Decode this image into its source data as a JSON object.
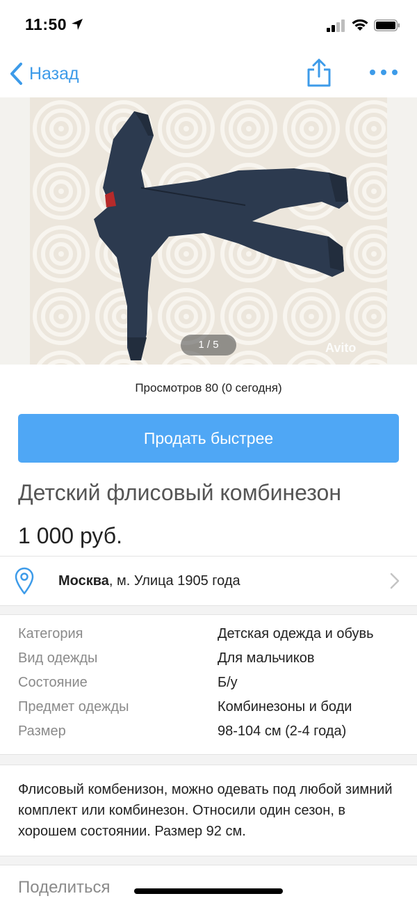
{
  "status_bar": {
    "time": "11:50"
  },
  "nav": {
    "back_label": "Назад",
    "accent_color": "#3d9be9"
  },
  "photo": {
    "counter": "1 / 5",
    "watermark": "Avito"
  },
  "views_text": "Просмотров 80 (0 сегодня)",
  "sell_button_label": "Продать быстрее",
  "listing": {
    "title": "Детский флисовый комбинезон",
    "price": "1 000 руб."
  },
  "location": {
    "city": "Москва",
    "metro": ", м. Улица 1905 года"
  },
  "params": [
    {
      "key": "Категория",
      "value": "Детская одежда и обувь"
    },
    {
      "key": "Вид одежды",
      "value": "Для мальчиков"
    },
    {
      "key": "Состояние",
      "value": "Б/у"
    },
    {
      "key": "Предмет одежды",
      "value": "Комбинезоны и боди"
    },
    {
      "key": "Размер",
      "value": "98-104 см (2-4 года)"
    }
  ],
  "description": "Флисовый комбенизон, можно одевать под любой зимний комплект или комбинезон. Относили один сезон, в хорошем состоянии. Размер 92 см.",
  "share_label": "Поделиться",
  "colors": {
    "button_blue": "#4fa7f5",
    "muted_text": "#8a8a8a"
  }
}
